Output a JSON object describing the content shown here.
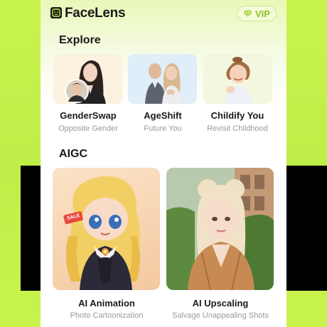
{
  "app": {
    "brand": "FaceLens",
    "vip_label": "VIP"
  },
  "explore": {
    "title": "Explore",
    "cards": [
      {
        "name": "GenderSwap",
        "subtitle": "Opposite Gender"
      },
      {
        "name": "AgeShift",
        "subtitle": "Future You"
      },
      {
        "name": "Childify You",
        "subtitle": "Revisit Childhood"
      }
    ]
  },
  "aigc": {
    "title": "AIGC",
    "cards": [
      {
        "name": "AI Animation",
        "subtitle": "Photo Cartoonization",
        "badge": "SALE"
      },
      {
        "name": "AI Upscaling",
        "subtitle": "Salvage Unappealing Shots"
      }
    ]
  },
  "colors": {
    "background": "#c4f04a",
    "accent": "#8fbf2a"
  }
}
